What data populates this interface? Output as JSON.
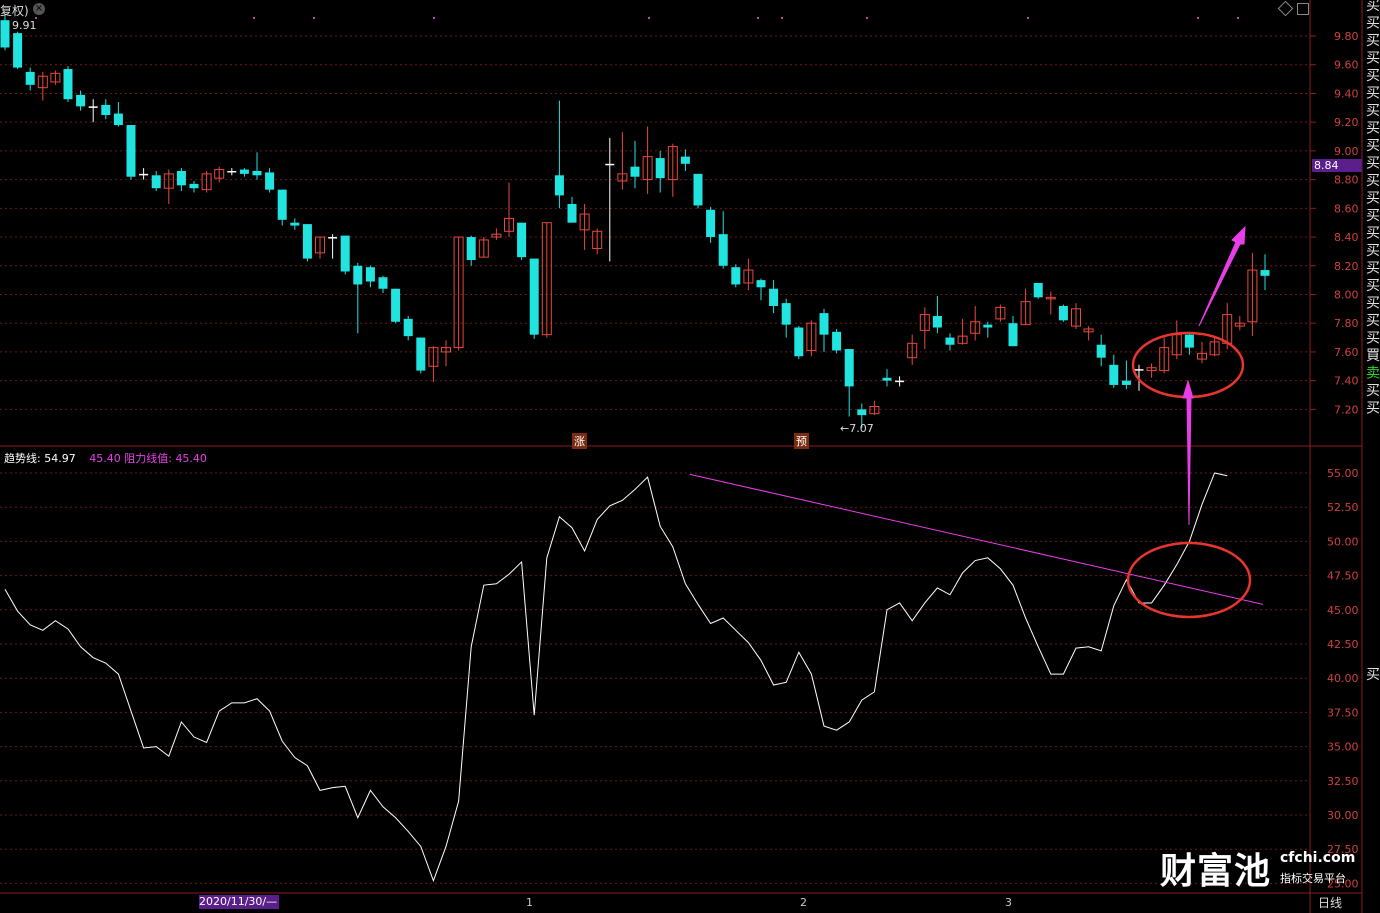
{
  "header": {
    "adjust_label": "复权)",
    "price_readout": "9.91"
  },
  "upper_axis_ticks": [
    "9.80",
    "9.60",
    "9.40",
    "9.20",
    "9.00",
    "8.80",
    "8.60",
    "8.40",
    "8.20",
    "8.00",
    "7.80",
    "7.60",
    "7.40",
    "7.20"
  ],
  "current_price_badge": "8.84",
  "low_marker": "7.07",
  "event_marks": [
    "涨",
    "预"
  ],
  "signal_column": [
    "买",
    "买",
    "买",
    "买",
    "买",
    "买",
    "买",
    "买",
    "买",
    "买",
    "买",
    "买",
    "买",
    "买",
    "买",
    "买",
    "买",
    "买",
    "买",
    "买",
    "買",
    "卖",
    "买",
    "买"
  ],
  "lower_legend": {
    "trend_name": "趋势线:",
    "trend_value": "54.97",
    "resist_prev": "45.40",
    "resist_name": "阻力线值:",
    "resist_value": "45.40"
  },
  "lower_axis_ticks": [
    "55.00",
    "52.50",
    "50.00",
    "47.50",
    "45.00",
    "42.50",
    "40.00",
    "37.50",
    "35.00",
    "32.50",
    "30.00",
    "27.50",
    "25.00"
  ],
  "lower_signal": "买",
  "date_axis": {
    "start_label": "2020/11/30/—",
    "month_labels": [
      "1",
      "2",
      "3"
    ]
  },
  "period_button": "日线",
  "watermark": {
    "brand": "财富池",
    "domain": "cfchi.com",
    "slogan": "指标交易平台"
  },
  "colors": {
    "up": "#e8483e",
    "down": "#21e4e0",
    "trend_line": "#ffffff",
    "resistance": "#e83ee8",
    "annotation_circle": "#e8352e",
    "annotation_arrow": "#e83ee8",
    "badge_bg": "#5a1f8a",
    "grid": "#6b1a1a"
  },
  "chart_data": [
    {
      "type": "candlestick",
      "title": "",
      "ylim": [
        7.0,
        9.95
      ],
      "y_ticks": [
        9.8,
        9.6,
        9.4,
        9.2,
        9.0,
        8.8,
        8.6,
        8.4,
        8.2,
        8.0,
        7.8,
        7.6,
        7.4,
        7.2
      ],
      "candles": [
        [
          9.91,
          9.72,
          9.95,
          9.7
        ],
        [
          9.82,
          9.58,
          9.83,
          9.57
        ],
        [
          9.55,
          9.46,
          9.58,
          9.42
        ],
        [
          9.44,
          9.52,
          9.55,
          9.35
        ],
        [
          9.48,
          9.54,
          9.56,
          9.46
        ],
        [
          9.57,
          9.36,
          9.59,
          9.34
        ],
        [
          9.39,
          9.31,
          9.42,
          9.28
        ],
        [
          9.31,
          9.31,
          9.36,
          9.2
        ],
        [
          9.32,
          9.25,
          9.36,
          9.22
        ],
        [
          9.26,
          9.18,
          9.34,
          9.17
        ],
        [
          9.18,
          8.82,
          9.18,
          8.8
        ],
        [
          8.84,
          8.84,
          8.88,
          8.8
        ],
        [
          8.83,
          8.74,
          8.86,
          8.72
        ],
        [
          8.74,
          8.84,
          8.87,
          8.63
        ],
        [
          8.86,
          8.76,
          8.88,
          8.72
        ],
        [
          8.77,
          8.74,
          8.79,
          8.71
        ],
        [
          8.73,
          8.84,
          8.86,
          8.71
        ],
        [
          8.81,
          8.87,
          8.89,
          8.78
        ],
        [
          8.86,
          8.86,
          8.88,
          8.83
        ],
        [
          8.87,
          8.84,
          8.88,
          8.82
        ],
        [
          8.86,
          8.83,
          8.99,
          8.8
        ],
        [
          8.85,
          8.73,
          8.88,
          8.71
        ],
        [
          8.73,
          8.52,
          8.73,
          8.48
        ],
        [
          8.5,
          8.48,
          8.53,
          8.45
        ],
        [
          8.49,
          8.25,
          8.49,
          8.23
        ],
        [
          8.29,
          8.4,
          8.4,
          8.25
        ],
        [
          8.4,
          8.4,
          8.42,
          8.25
        ],
        [
          8.41,
          8.16,
          8.41,
          8.14
        ],
        [
          8.2,
          8.07,
          8.22,
          7.73
        ],
        [
          8.19,
          8.09,
          8.2,
          8.05
        ],
        [
          8.12,
          8.04,
          8.13,
          8.01
        ],
        [
          8.04,
          7.81,
          8.04,
          7.8
        ],
        [
          7.83,
          7.71,
          7.85,
          7.68
        ],
        [
          7.7,
          7.47,
          7.7,
          7.45
        ],
        [
          7.5,
          7.63,
          7.64,
          7.39
        ],
        [
          7.6,
          7.63,
          7.68,
          7.5
        ],
        [
          7.63,
          8.4,
          8.4,
          7.61
        ],
        [
          8.4,
          8.24,
          8.41,
          8.2
        ],
        [
          8.26,
          8.38,
          8.4,
          8.26
        ],
        [
          8.4,
          8.42,
          8.46,
          8.38
        ],
        [
          8.44,
          8.53,
          8.78,
          8.4
        ],
        [
          8.5,
          8.26,
          8.5,
          8.24
        ],
        [
          8.25,
          7.72,
          8.25,
          7.69
        ],
        [
          7.72,
          8.5,
          8.5,
          7.7
        ],
        [
          8.83,
          8.69,
          9.35,
          8.6
        ],
        [
          8.63,
          8.5,
          8.68,
          8.58
        ],
        [
          8.45,
          8.56,
          8.63,
          8.31
        ],
        [
          8.32,
          8.44,
          8.46,
          8.28
        ],
        [
          8.91,
          8.91,
          9.09,
          8.23
        ],
        [
          8.79,
          8.84,
          9.13,
          8.73
        ],
        [
          8.89,
          8.82,
          9.07,
          8.74
        ],
        [
          8.8,
          8.96,
          9.17,
          8.7
        ],
        [
          8.95,
          8.81,
          9.0,
          8.71
        ],
        [
          8.8,
          9.03,
          9.05,
          8.68
        ],
        [
          8.96,
          8.91,
          9.01,
          8.86
        ],
        [
          8.84,
          8.62,
          8.84,
          8.6
        ],
        [
          8.59,
          8.4,
          8.61,
          8.36
        ],
        [
          8.42,
          8.2,
          8.58,
          8.18
        ],
        [
          8.19,
          8.07,
          8.21,
          8.05
        ],
        [
          8.08,
          8.17,
          8.25,
          8.03
        ],
        [
          8.1,
          8.05,
          8.11,
          7.96
        ],
        [
          8.04,
          7.92,
          8.1,
          7.87
        ],
        [
          7.94,
          7.79,
          7.97,
          7.7
        ],
        [
          7.77,
          7.57,
          7.78,
          7.55
        ],
        [
          7.61,
          7.8,
          7.82,
          7.57
        ],
        [
          7.87,
          7.72,
          7.9,
          7.6
        ],
        [
          7.74,
          7.61,
          7.76,
          7.59
        ],
        [
          7.62,
          7.36,
          7.62,
          7.15
        ],
        [
          7.2,
          7.16,
          7.24,
          7.07
        ],
        [
          7.17,
          7.22,
          7.26,
          7.16
        ],
        [
          7.42,
          7.4,
          7.48,
          7.36
        ],
        [
          7.4,
          7.4,
          7.43,
          7.36
        ],
        [
          7.56,
          7.66,
          7.72,
          7.51
        ],
        [
          7.75,
          7.86,
          7.91,
          7.62
        ],
        [
          7.85,
          7.77,
          7.99,
          7.73
        ],
        [
          7.7,
          7.65,
          7.73,
          7.61
        ],
        [
          7.66,
          7.71,
          7.83,
          7.65
        ],
        [
          7.73,
          7.81,
          7.92,
          7.68
        ],
        [
          7.79,
          7.77,
          7.81,
          7.7
        ],
        [
          7.83,
          7.91,
          7.93,
          7.81
        ],
        [
          7.8,
          7.64,
          7.85,
          7.64
        ],
        [
          7.79,
          7.95,
          8.04,
          7.79
        ],
        [
          8.08,
          7.98,
          8.08,
          7.97
        ],
        [
          7.97,
          7.98,
          8.02,
          7.86
        ],
        [
          7.92,
          7.82,
          7.93,
          7.81
        ],
        [
          7.78,
          7.9,
          7.94,
          7.76
        ],
        [
          7.74,
          7.76,
          7.78,
          7.68
        ],
        [
          7.65,
          7.56,
          7.72,
          7.5
        ],
        [
          7.51,
          7.37,
          7.58,
          7.35
        ],
        [
          7.4,
          7.37,
          7.54,
          7.34
        ],
        [
          7.48,
          7.48,
          7.51,
          7.33
        ],
        [
          7.47,
          7.49,
          7.52,
          7.42
        ],
        [
          7.47,
          7.63,
          7.7,
          7.45
        ],
        [
          7.58,
          7.72,
          7.82,
          7.55
        ],
        [
          7.72,
          7.63,
          7.74,
          7.58
        ],
        [
          7.55,
          7.59,
          7.67,
          7.52
        ],
        [
          7.58,
          7.67,
          7.7,
          7.57
        ],
        [
          7.66,
          7.86,
          7.94,
          7.62
        ],
        [
          7.78,
          7.8,
          7.85,
          7.75
        ],
        [
          7.81,
          8.17,
          8.29,
          7.71
        ],
        [
          8.17,
          8.13,
          8.28,
          8.03
        ]
      ]
    },
    {
      "type": "line",
      "title": "",
      "ylim": [
        25.0,
        55.0
      ],
      "y_ticks": [
        55.0,
        52.5,
        50.0,
        47.5,
        45.0,
        42.5,
        40.0,
        37.5,
        35.0,
        32.5,
        30.0,
        27.5,
        25.0
      ],
      "series": [
        {
          "name": "趋势线",
          "values": [
            46.5,
            44.9,
            43.9,
            43.5,
            44.2,
            43.6,
            42.3,
            41.5,
            41.1,
            40.3,
            37.6,
            34.9,
            35.0,
            34.3,
            36.8,
            35.7,
            35.3,
            37.6,
            38.2,
            38.2,
            38.5,
            37.6,
            35.4,
            34.2,
            33.6,
            31.8,
            32.0,
            32.1,
            29.8,
            31.8,
            30.6,
            29.8,
            28.8,
            27.7,
            25.2,
            27.7,
            31.0,
            42.3,
            46.8,
            46.9,
            47.6,
            48.5,
            37.3,
            48.8,
            51.8,
            51.0,
            49.3,
            51.6,
            52.6,
            53.0,
            53.8,
            54.7,
            51.1,
            49.6,
            46.9,
            45.4,
            44.0,
            44.4,
            43.5,
            42.6,
            41.3,
            39.5,
            39.7,
            41.9,
            40.3,
            36.5,
            36.2,
            36.8,
            38.4,
            39.0,
            45.0,
            45.5,
            44.2,
            45.5,
            46.6,
            46.1,
            47.7,
            48.6,
            48.8,
            48.0,
            46.8,
            44.4,
            42.3,
            40.3,
            40.3,
            42.2,
            42.3,
            42.0,
            45.3,
            47.2,
            45.5,
            45.5,
            46.8,
            48.3,
            50.0,
            52.7,
            55.0,
            54.8
          ]
        },
        {
          "name": "阻力线值",
          "values": [
            54.9,
            45.4
          ]
        }
      ]
    }
  ]
}
